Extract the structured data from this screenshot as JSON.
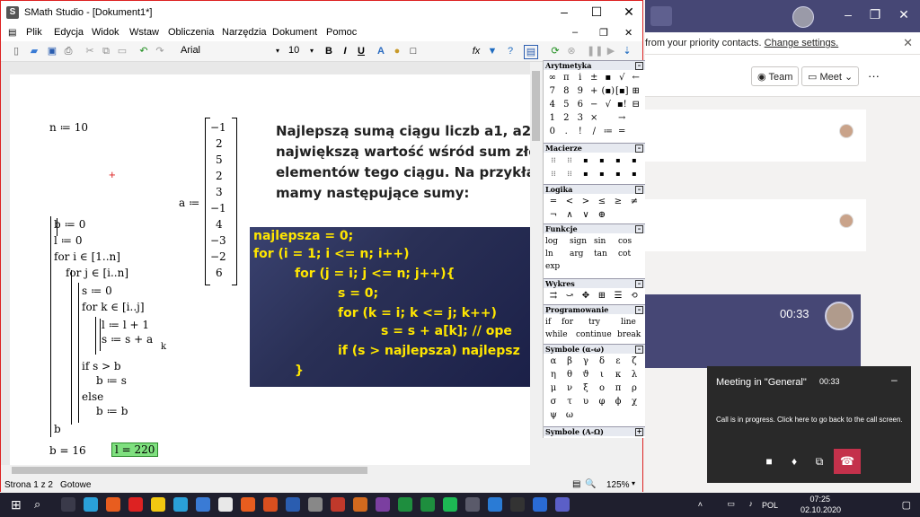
{
  "teams": {
    "banner_text": "from your priority contacts.",
    "banner_link": "Change settings.",
    "team_button": "Team",
    "meet_button": "Meet",
    "more": "···",
    "call_time": "00:33",
    "popup": {
      "title": "Meeting in \"General\"",
      "duration": "00:33",
      "message": "Call is in progress. Click here to go back to the call screen."
    }
  },
  "smath": {
    "title": "SMath Studio - [Dokument1*]",
    "menu": [
      "Plik",
      "Edycja",
      "Widok",
      "Wstaw",
      "Obliczenia",
      "Narzędzia",
      "Dokument",
      "Pomoc"
    ],
    "font_name": "Arial",
    "font_size": "10",
    "toolbar_b": "B",
    "toolbar_i": "I",
    "toolbar_u": "U",
    "toolbar_fx": "fx",
    "sheet": {
      "n_def": "n ≔ 10",
      "a_label": "a ≔",
      "a_values": [
        "−1",
        "2",
        "5",
        "2",
        "3",
        "−1",
        "4",
        "−3",
        "−2",
        "6"
      ],
      "prog": [
        "b ≔ 0",
        "l ≔ 0",
        "for  i ∈ [1..n]",
        "for  j ∈ [i..n]",
        "s ≔ 0",
        "for  k ∈ [i..j]",
        "l ≔ l + 1",
        "s ≔ s + a",
        "k",
        "if  s > b",
        "b ≔ s",
        "else",
        "b ≔ b",
        "b"
      ],
      "result_b": "b = 16",
      "result_l": "l = 220",
      "heading": [
        "Najlepszą sumą ciągu liczb a1, a2, ...",
        "największą wartość wśród sum złoż",
        "elementów tego ciągu. Na przykład",
        "mamy następujące sumy:"
      ],
      "code": [
        "najlepsza = 0;",
        "for (i = 1; i <= n; i++)",
        "for (j = i; j <= n; j++){",
        "s = 0;",
        "for (k = i; k <= j; k++)",
        "s = s + a[k]; // ope",
        "if (s > najlepsza) najlepsz",
        "}"
      ]
    },
    "status": {
      "page": "Strona 1 z 2",
      "state": "Gotowe",
      "zoom": "125%"
    },
    "panels": {
      "arytmetyka": {
        "title": "Arytmetyka",
        "cells": [
          "∞",
          "π",
          "i",
          "±",
          "▪",
          "√",
          "←",
          "7",
          "8",
          "9",
          "+",
          "(▪)",
          "[▪]",
          "⊞",
          "4",
          "5",
          "6",
          "−",
          "√",
          "▪!",
          "⊟",
          "1",
          "2",
          "3",
          "×",
          "",
          "→",
          "",
          "0",
          ".",
          "!",
          "/",
          "≔",
          "=",
          ""
        ]
      },
      "macierze": {
        "title": "Macierze"
      },
      "logika": {
        "title": "Logika",
        "cells": [
          "=",
          "<",
          ">",
          "≤",
          "≥",
          "≠",
          "¬",
          "∧",
          "∨",
          "⊕"
        ]
      },
      "funkcje": {
        "title": "Funkcje",
        "words": [
          "log",
          "sign",
          "sin",
          "cos",
          "ln",
          "arg",
          "tan",
          "cot",
          "exp"
        ]
      },
      "wykres": {
        "title": "Wykres"
      },
      "programowanie": {
        "title": "Programowanie",
        "words": [
          "if",
          "for",
          "try",
          "line",
          "while",
          "continue",
          "break"
        ]
      },
      "symbole_greek": {
        "title": "Symbole (α-ω)",
        "cells": [
          "α",
          "β",
          "γ",
          "δ",
          "ε",
          "ζ",
          "η",
          "θ",
          "ϑ",
          "ι",
          "κ",
          "λ",
          "μ",
          "ν",
          "ξ",
          "ο",
          "π",
          "ρ",
          "σ",
          "τ",
          "υ",
          "φ",
          "ϕ",
          "χ",
          "ψ",
          "ω"
        ]
      },
      "symbole_latin": {
        "title": "Symbole (A-Ω)"
      }
    }
  },
  "taskbar": {
    "lang": "POL",
    "time": "07:25",
    "date": "02.10.2020"
  }
}
